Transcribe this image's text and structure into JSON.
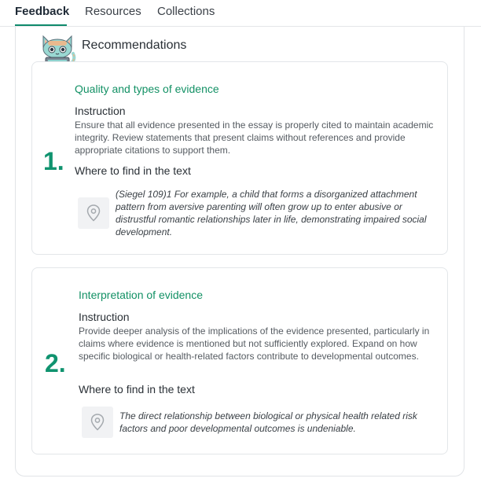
{
  "tabs": [
    {
      "label": "Feedback",
      "active": true
    },
    {
      "label": "Resources",
      "active": false
    },
    {
      "label": "Collections",
      "active": false
    }
  ],
  "recommendations": {
    "title": "Recommendations",
    "items": [
      {
        "number": "1.",
        "category": "Quality and types of evidence",
        "instruction_label": "Instruction",
        "instruction": "Ensure that all evidence presented in the essay is properly cited to maintain academic integrity. Review statements that present claims without references and provide appropriate citations to support them.",
        "where_label": "Where to find in the text",
        "quote": "(Siegel 109)1 For example, a child that forms a disorganized attachment pattern from aversive parenting will often grow up to enter abusive or distrustful romantic relationships later in life, demonstrating impaired social development.",
        "icon": "location-pin-icon"
      },
      {
        "number": "2.",
        "category": "Interpretation of evidence",
        "instruction_label": "Instruction",
        "instruction": "Provide deeper analysis of the implications of the evidence presented, particularly in claims where evidence is mentioned but not sufficiently explored. Expand on how specific biological or health-related factors contribute to developmental outcomes.",
        "where_label": "Where to find in the text",
        "quote": "The direct relationship between biological or physical health related risk factors and poor developmental outcomes is undeniable.",
        "icon": "location-pin-icon"
      }
    ]
  },
  "colors": {
    "accent": "#10936f",
    "tab_underline": "#0f8a6c"
  }
}
